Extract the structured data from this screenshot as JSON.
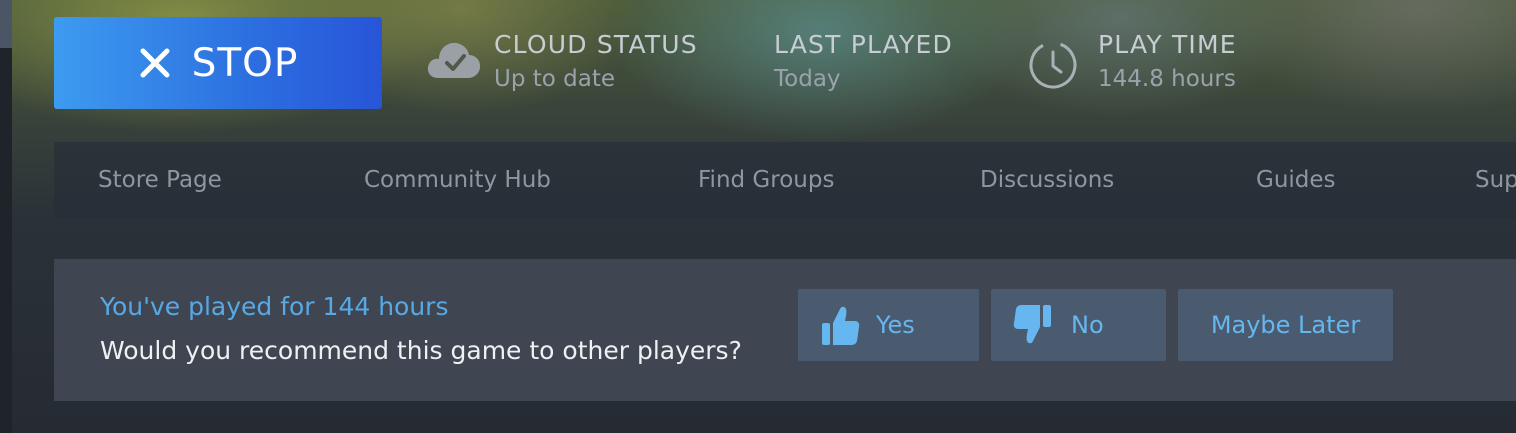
{
  "toolbar": {
    "stop_label": "STOP",
    "stop_icon": "close-x-icon"
  },
  "stats": {
    "cloud": {
      "label": "CLOUD STATUS",
      "value": "Up to date",
      "icon": "cloud-check-icon"
    },
    "last_played": {
      "label": "LAST PLAYED",
      "value": "Today"
    },
    "play_time": {
      "label": "PLAY TIME",
      "value": "144.8 hours",
      "icon": "clock-icon"
    }
  },
  "nav": {
    "items": [
      {
        "label": "Store Page"
      },
      {
        "label": "Community Hub"
      },
      {
        "label": "Find Groups"
      },
      {
        "label": "Discussions"
      },
      {
        "label": "Guides"
      },
      {
        "label": "Sup"
      }
    ]
  },
  "review": {
    "hours_text": "You've played for 144 hours",
    "question": "Would you recommend this game to other players?",
    "yes_label": "Yes",
    "no_label": "No",
    "later_label": "Maybe Later"
  },
  "colors": {
    "stop_gradient_start": "#3d9bf0",
    "stop_gradient_end": "#2855d8",
    "accent_blue": "#57a9e6",
    "button_bg": "#4a5b70",
    "panel_bg": "#3f4652"
  }
}
